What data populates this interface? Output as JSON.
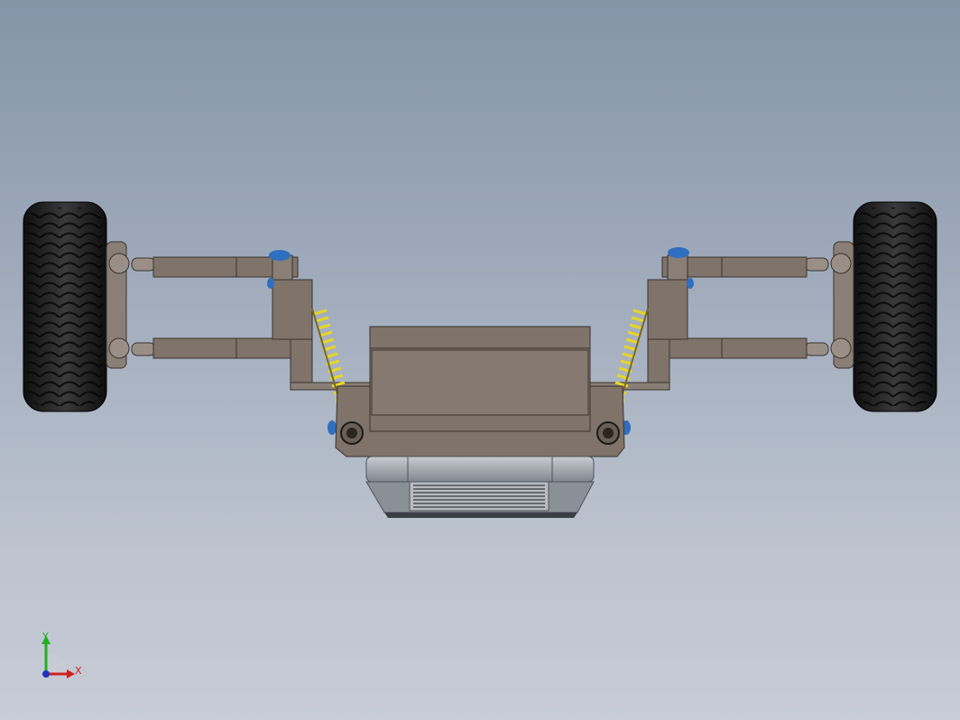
{
  "viewport": {
    "background_top": "#8594a8",
    "background_bottom": "#c7ccd6"
  },
  "model": {
    "view": "front",
    "parts": [
      "tire-left",
      "tire-right",
      "upper-control-arm-left",
      "lower-control-arm-left",
      "upper-control-arm-right",
      "lower-control-arm-right",
      "coil-spring-left",
      "coil-spring-right",
      "crossmember",
      "radiator"
    ],
    "colors": {
      "frame": "#7f736a",
      "tire": "#1e1e1e",
      "spring": "#e0d22a",
      "bushing": "#2f6fc0",
      "radiator": "#9aa0a8"
    }
  },
  "triad": {
    "x_label": "X",
    "y_label": "Y",
    "x_color": "#d02020",
    "y_color": "#20b020",
    "z_color": "#2030c0"
  }
}
